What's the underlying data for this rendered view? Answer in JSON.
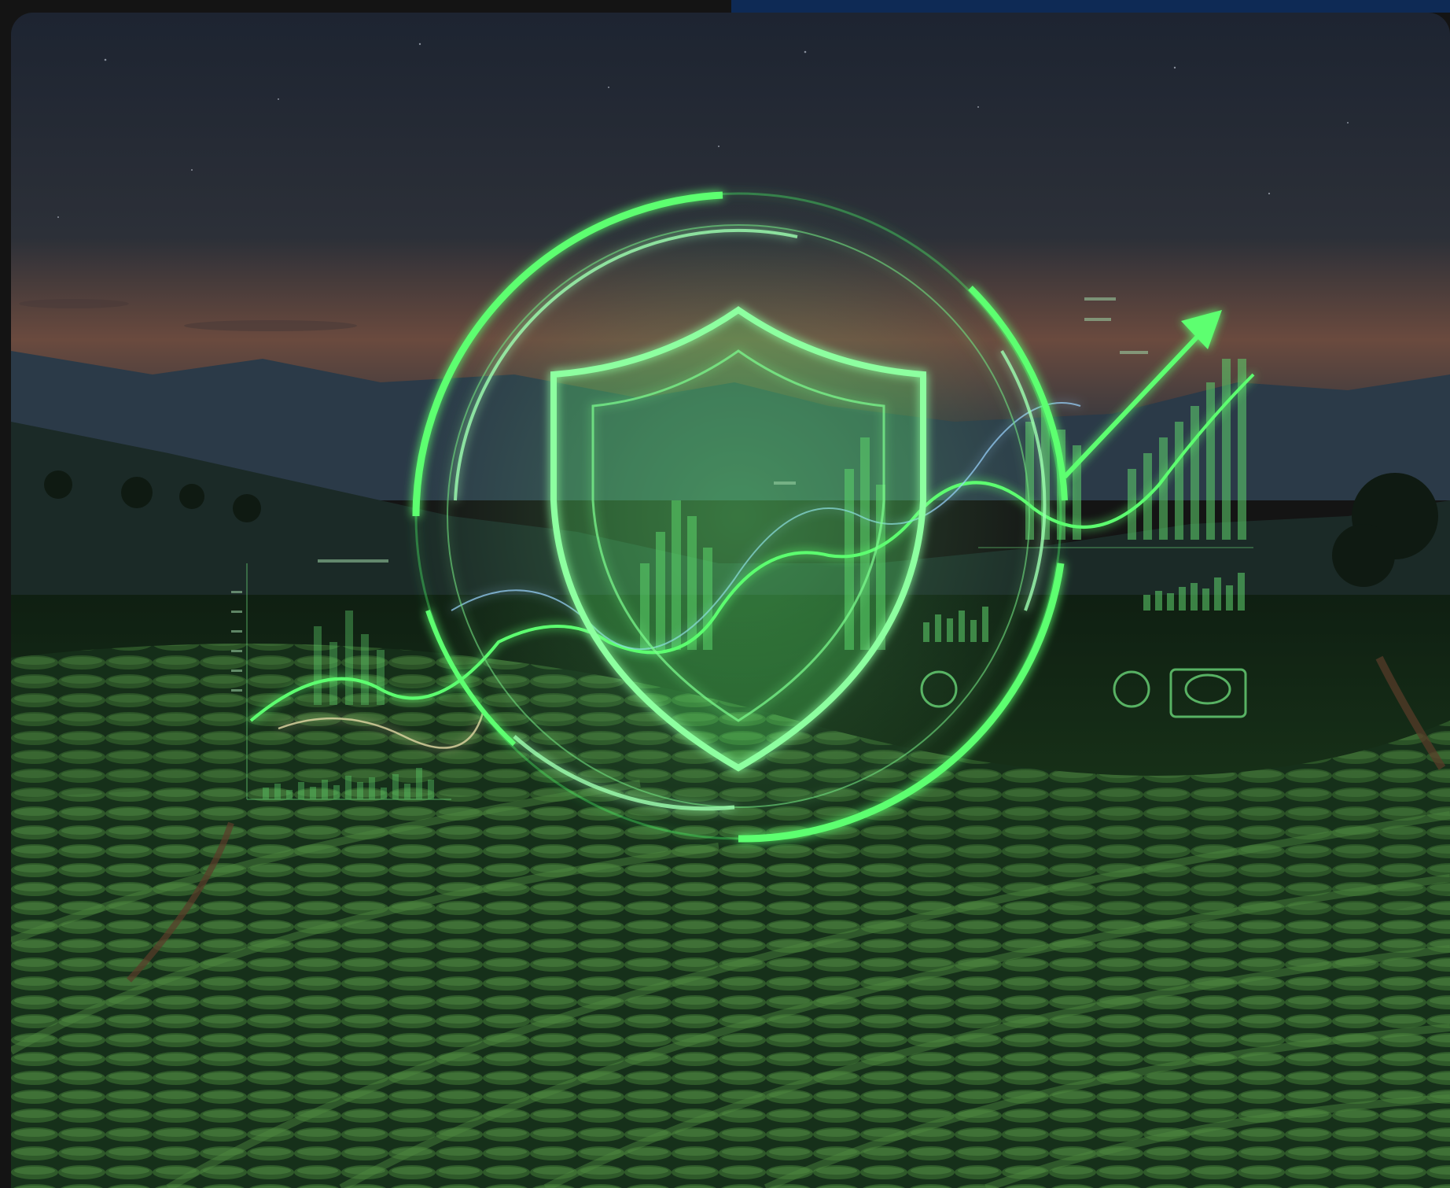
{
  "image": {
    "kind": "photo-illustration",
    "palette": {
      "sky_top": "#1a2230",
      "sky_horizon": "#8a5a45",
      "mountain_far": "#2b3a4a",
      "mountain_near": "#1c2a2a",
      "field_dark": "#0c1a0d",
      "field_mid": "#1e3d1c",
      "field_light": "#3f6e33",
      "glow": "#4dff6a",
      "glow_soft": "#9dffb0"
    },
    "icons": [
      "shield-icon",
      "up-arrow-icon",
      "ring-icon"
    ]
  }
}
